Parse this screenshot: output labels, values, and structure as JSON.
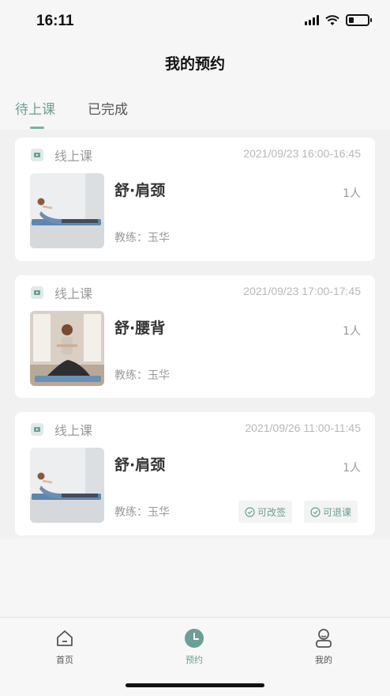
{
  "status_bar": {
    "time": "16:11",
    "battery_level": 0.25
  },
  "page_title": "我的预约",
  "tabs": [
    {
      "label": "待上课",
      "active": true
    },
    {
      "label": "已完成",
      "active": false
    }
  ],
  "bookings": [
    {
      "category": "线上课",
      "time": "2021/09/23 16:00-16:45",
      "course": "舒·肩颈",
      "people": "1人",
      "coach": "教练：玉华",
      "image": "yoga-pose-lying-icon",
      "actions": []
    },
    {
      "category": "线上课",
      "time": "2021/09/23 17:00-17:45",
      "course": "舒·腰背",
      "people": "1人",
      "coach": "教练：玉华",
      "image": "yoga-pose-seated-twist-icon",
      "actions": []
    },
    {
      "category": "线上课",
      "time": "2021/09/26 11:00-11:45",
      "course": "舒·肩颈",
      "people": "1人",
      "coach": "教练：玉华",
      "image": "yoga-pose-lying-icon",
      "actions": [
        "可改签",
        "可退课"
      ]
    }
  ],
  "tabbar": [
    {
      "label": "首页",
      "icon": "home-icon",
      "active": false
    },
    {
      "label": "预约",
      "icon": "clock-icon",
      "active": true
    },
    {
      "label": "我的",
      "icon": "user-icon",
      "active": false
    }
  ],
  "colors": {
    "accent": "#6aa096",
    "background": "#f6f6f6",
    "card": "#ffffff"
  }
}
